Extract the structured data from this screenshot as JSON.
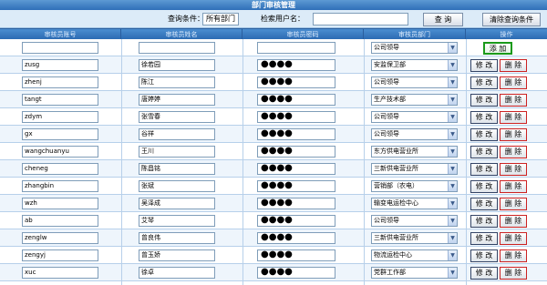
{
  "title": "部门审核管理",
  "query": {
    "condition_label": "查询条件：",
    "condition_value": "所有部门",
    "user_label": "检索用户名：",
    "user_value": "",
    "search_button": "查 询",
    "clear_button": "清除查询条件"
  },
  "columns": [
    "审核员账号",
    "审核员姓名",
    "审核员密码",
    "审核员部门",
    "操作"
  ],
  "add_button": "添 加",
  "edit_button": "修 改",
  "delete_button": "删 除",
  "new_row": {
    "account": "",
    "name": "",
    "password": "",
    "department": "公司领导"
  },
  "rows": [
    {
      "account": "zusg",
      "name": "徐若园",
      "password": "●●●●",
      "department": "安监保卫部"
    },
    {
      "account": "zhenj",
      "name": "陈江",
      "password": "●●●●",
      "department": "公司领导"
    },
    {
      "account": "tangt",
      "name": "唐婷婷",
      "password": "●●●●",
      "department": "生产技术部"
    },
    {
      "account": "zdym",
      "name": "张雪春",
      "password": "●●●●",
      "department": "公司领导"
    },
    {
      "account": "gx",
      "name": "谷祥",
      "password": "●●●●",
      "department": "公司领导"
    },
    {
      "account": "wangchuanyu",
      "name": "王川",
      "password": "●●●●",
      "department": "东方供电营业所"
    },
    {
      "account": "cheneg",
      "name": "陈昌铭",
      "password": "●●●●",
      "department": "三新供电营业所"
    },
    {
      "account": "zhangbin",
      "name": "张斌",
      "password": "●●●●",
      "department": "营销部（农电）"
    },
    {
      "account": "wzh",
      "name": "吴泽成",
      "password": "●●●●",
      "department": "输变电运检中心"
    },
    {
      "account": "ab",
      "name": "艾琴",
      "password": "●●●●",
      "department": "公司领导"
    },
    {
      "account": "zenglw",
      "name": "曾良伟",
      "password": "●●●●",
      "department": "三新供电营业所"
    },
    {
      "account": "zengyj",
      "name": "曾玉娇",
      "password": "●●●●",
      "department": "物流运检中心"
    },
    {
      "account": "xuc",
      "name": "徐卓",
      "password": "●●●●",
      "department": "党群工作部"
    }
  ]
}
